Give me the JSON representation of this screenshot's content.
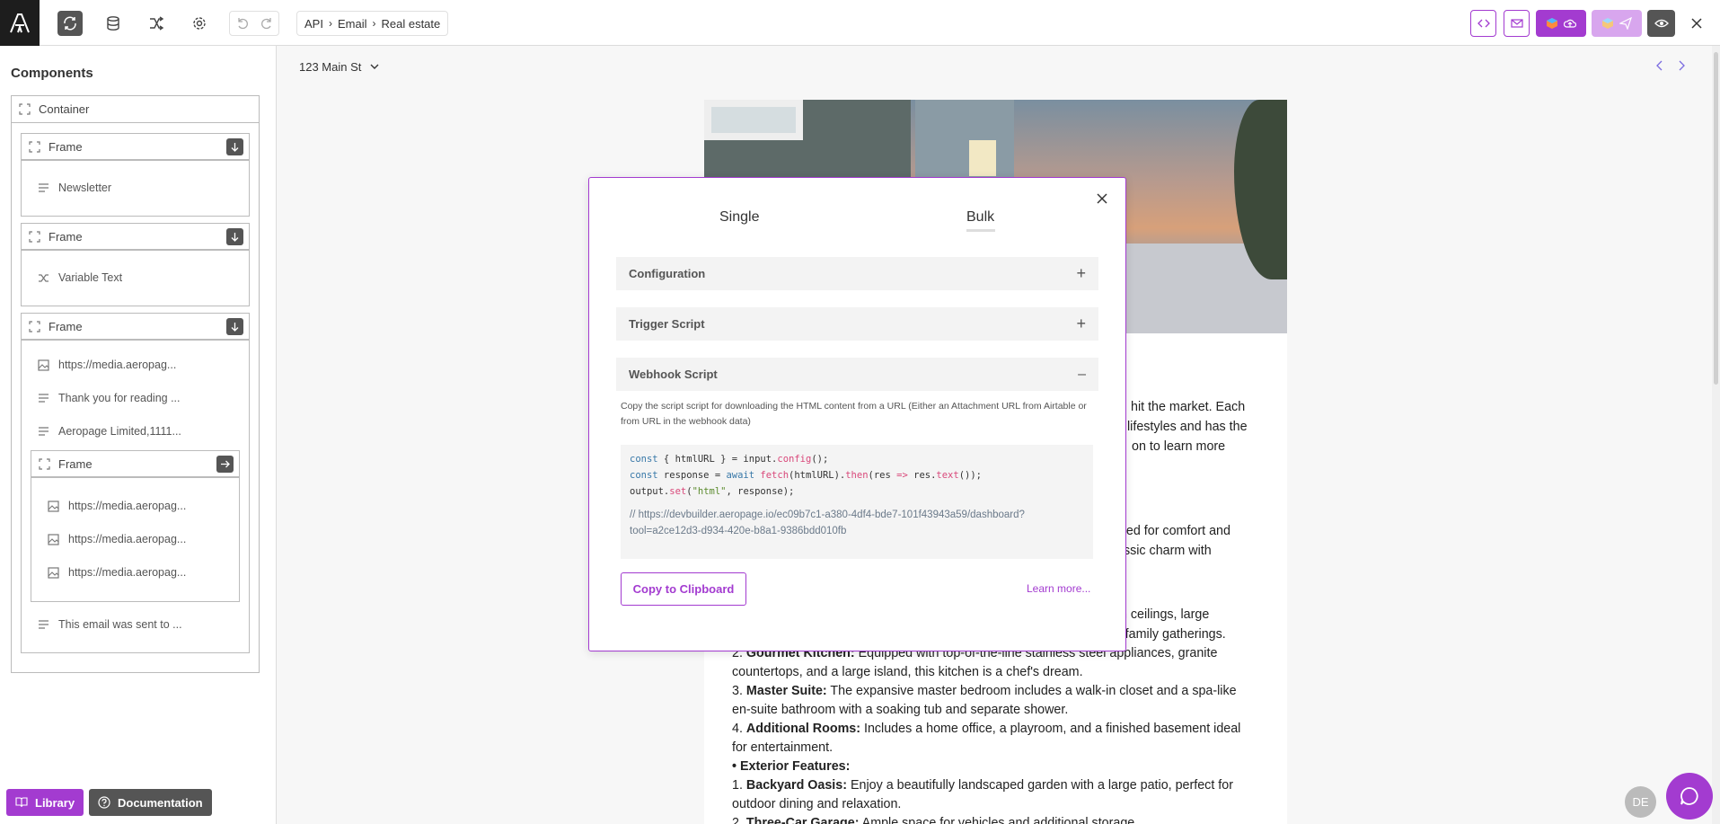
{
  "topbar": {
    "breadcrumb": [
      "API",
      "Email",
      "Real estate"
    ],
    "icons": [
      "refresh-icon",
      "database-icon",
      "shuffle-icon",
      "gear-icon",
      "undo-icon",
      "redo-icon",
      "code-icon",
      "mail-icon",
      "upload-icon",
      "send-icon",
      "eye-icon",
      "close-icon"
    ]
  },
  "sidebar": {
    "title": "Components",
    "container_label": "Container",
    "frames": [
      {
        "label": "Frame",
        "items": [
          "Newsletter"
        ]
      },
      {
        "label": "Frame",
        "items": [
          "Variable Text"
        ]
      },
      {
        "label": "Frame",
        "items": [
          "https://media.aeropag...",
          "Thank you for reading ...",
          "Aeropage Limited,1111..."
        ]
      }
    ],
    "nested_frame": {
      "label": "Frame",
      "items": [
        "https://media.aeropag...",
        "https://media.aeropag...",
        "https://media.aeropag..."
      ]
    },
    "footer_item": "This email was sent to ...",
    "library_label": "Library",
    "documentation_label": "Documentation"
  },
  "main": {
    "address_select": "123 Main St",
    "email_lines": [
      {
        "text": "hit the market. Each"
      },
      {
        "text": "lifestyles and has the"
      },
      {
        "text": "on to learn more"
      },
      {
        "text": "gned for comfort and"
      },
      {
        "text": "assic charm with"
      },
      {
        "text": "gh ceilings, large"
      },
      {
        "text": "or family gatherings."
      }
    ],
    "features": [
      {
        "num": "2.",
        "bold": "Gourmet Kitchen:",
        "text": " Equipped with top-of-the-line stainless steel appliances, granite"
      },
      {
        "num": "",
        "bold": "",
        "text": "countertops, and a large island, this kitchen is a chef's dream."
      },
      {
        "num": "3.",
        "bold": "Master Suite:",
        "text": " The expansive master bedroom includes a walk-in closet and a spa-like"
      },
      {
        "num": "",
        "bold": "",
        "text": "en-suite bathroom with a soaking tub and separate shower."
      },
      {
        "num": "4.",
        "bold": "Additional Rooms:",
        "text": " Includes a home office, a playroom, and a finished basement ideal"
      },
      {
        "num": "",
        "bold": "",
        "text": "for entertainment."
      },
      {
        "num": "•",
        "bold": "Exterior Features:",
        "text": ""
      },
      {
        "num": "1.",
        "bold": "Backyard Oasis:",
        "text": " Enjoy a beautifully landscaped garden with a large patio, perfect for"
      },
      {
        "num": "",
        "bold": "",
        "text": "outdoor dining and relaxation."
      },
      {
        "num": "2.",
        "bold": "Three-Car Garage:",
        "text": " Ample space for vehicles and additional storage."
      }
    ],
    "avatar_initials": "DE"
  },
  "modal": {
    "tabs": [
      "Single",
      "Bulk"
    ],
    "active_tab": "Bulk",
    "sections": [
      {
        "label": "Configuration",
        "state": "+"
      },
      {
        "label": "Trigger Script",
        "state": "+"
      },
      {
        "label": "Webhook Script",
        "state": "–"
      }
    ],
    "description": "Copy the script script for downloading the HTML content from a URL (Either an Attachment URL from Airtable or from URL in the webhook data)",
    "code_comment": "// https://devbuilder.aeropage.io/ec09b7c1-a380-4df4-bde7-101f43943a59/dashboard?tool=a2ce12d3-d934-420e-b8a1-9386bdd010fb",
    "copy_label": "Copy to Clipboard",
    "learn_label": "Learn more..."
  },
  "colors": {
    "accent": "#a33bd0",
    "dark": "#1d1d1d"
  }
}
